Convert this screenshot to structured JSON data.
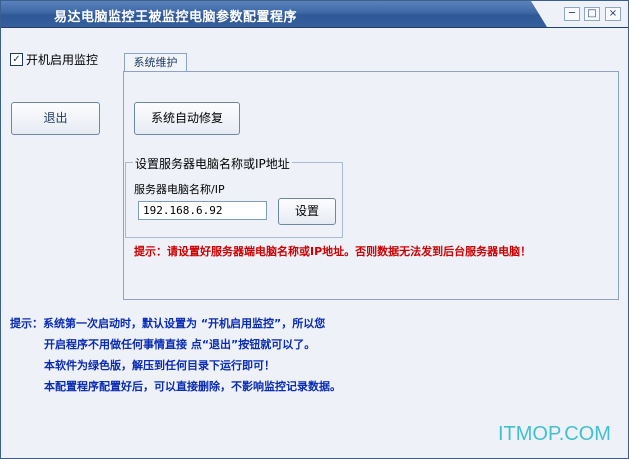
{
  "window": {
    "title": "易达电脑监控王被监控电脑参数配置程序",
    "controls": {
      "minimize": "─",
      "maximize": "□",
      "close": "×"
    }
  },
  "autostart": {
    "label": "开机启用监控",
    "checked": true,
    "mark": "✓"
  },
  "exit_button": {
    "label": "退出"
  },
  "tab": {
    "label": "系统维护"
  },
  "repair_button": {
    "label": "系统自动修复"
  },
  "server_group": {
    "title": "设置服务器电脑名称或IP地址",
    "field_label": "服务器电脑名称/IP",
    "value": "192.168.6.92",
    "set_button": "设置"
  },
  "warning": "提示：请设置好服务器端电脑名称或IP地址。否则数据无法发到后台服务器电脑！",
  "tips": [
    "提示：系统第一次启动时，默认设置为 “开机启用监控”，所以您",
    "开启程序不用做任何事情直接 点“退出”按钮就可以了。",
    "本软件为绿色版，解压到任何目录下运行即可！",
    "本配置程序配置好后，可以直接删除，不影响监控记录数据。"
  ],
  "watermark": "ITMOP.COM",
  "colors": {
    "title_bar": "#3d67a6",
    "warning": "#cc0000",
    "tips": "#0a2bb3",
    "watermark": "#42c0cf"
  }
}
